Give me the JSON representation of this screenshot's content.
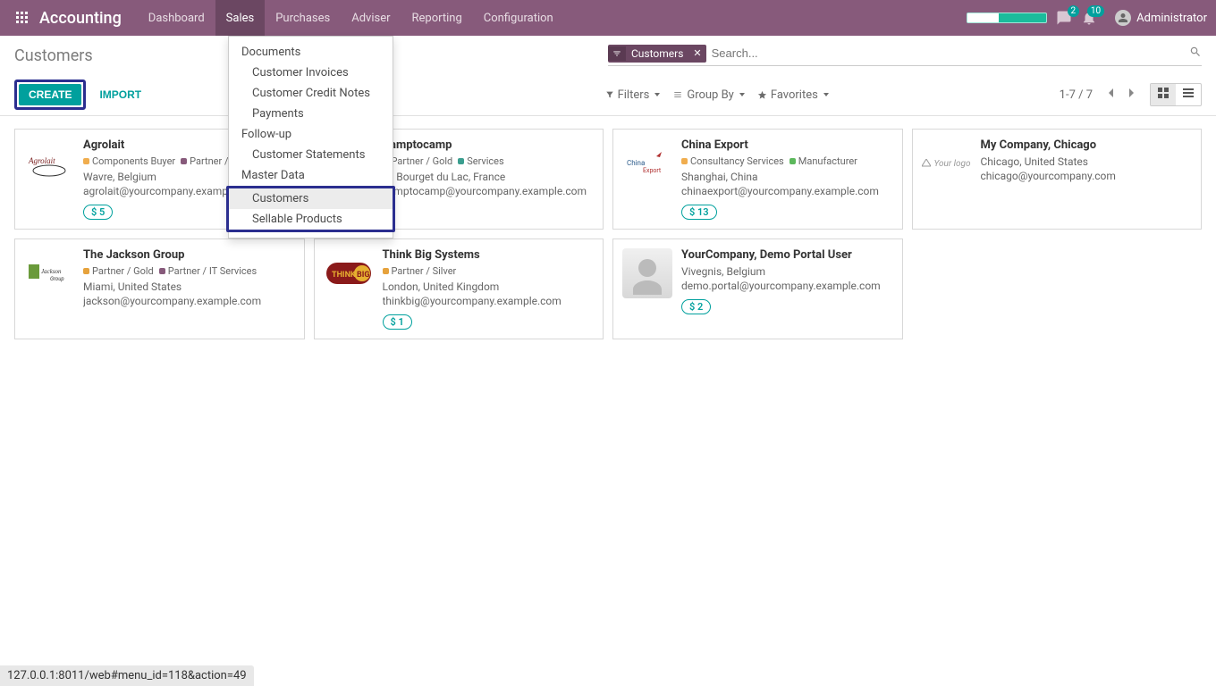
{
  "brand": "Accounting",
  "nav": {
    "items": [
      "Dashboard",
      "Sales",
      "Purchases",
      "Adviser",
      "Reporting",
      "Configuration"
    ],
    "activeIndex": 1
  },
  "topRight": {
    "messagesBadge": "2",
    "activitiesBadge": "10",
    "user": "Administrator"
  },
  "breadcrumb": "Customers",
  "toolbar": {
    "create": "Create",
    "import": "Import"
  },
  "search": {
    "facetLabel": "Customers",
    "placeholder": "Search..."
  },
  "filters": {
    "filters": "Filters",
    "groupBy": "Group By",
    "favorites": "Favorites"
  },
  "pager": "1-7 / 7",
  "dropdown": {
    "sections": [
      {
        "header": "Documents",
        "items": [
          "Customer Invoices",
          "Customer Credit Notes",
          "Payments"
        ]
      },
      {
        "header": "Follow-up",
        "items": [
          "Customer Statements"
        ]
      },
      {
        "header": "Master Data",
        "items": [
          "Customers",
          "Sellable Products"
        ]
      }
    ],
    "activeItem": "Customers"
  },
  "tagColors": {
    "orange": "#f0ad4e",
    "purple": "#875a7b",
    "teal": "#3b9e8f",
    "green": "#5cb85c",
    "gold": "#e6a23c"
  },
  "cards": [
    {
      "title": "Agrolait",
      "tags": [
        {
          "label": "Components Buyer",
          "color": "orange"
        },
        {
          "label": "Partner / IT Services",
          "color": "purple"
        }
      ],
      "loc": "Wavre, Belgium",
      "email": "agrolait@yourcompany.example.com",
      "amount": "$ 5",
      "logo": "agrolait"
    },
    {
      "title": "Camptocamp",
      "tags": [
        {
          "label": "Partner / Gold",
          "color": "orange"
        },
        {
          "label": "Services",
          "color": "teal"
        }
      ],
      "loc": "Le Bourget du Lac, France",
      "email": "camptocamp@yourcompany.example.com",
      "logo": "none"
    },
    {
      "title": "China Export",
      "tags": [
        {
          "label": "Consultancy Services",
          "color": "orange"
        },
        {
          "label": "Manufacturer",
          "color": "green"
        }
      ],
      "loc": "Shanghai, China",
      "email": "chinaexport@yourcompany.example.com",
      "amount": "$ 13",
      "logo": "chinaexport"
    },
    {
      "title": "My Company, Chicago",
      "tags": [],
      "loc": "Chicago, United States",
      "email": "chicago@yourcompany.com",
      "logo": "yourlogo"
    },
    {
      "title": "The Jackson Group",
      "tags": [
        {
          "label": "Partner / Gold",
          "color": "gold"
        },
        {
          "label": "Partner / IT Services",
          "color": "purple"
        }
      ],
      "loc": "Miami, United States",
      "email": "jackson@yourcompany.example.com",
      "logo": "jackson"
    },
    {
      "title": "Think Big Systems",
      "tags": [
        {
          "label": "Partner / Silver",
          "color": "gold"
        }
      ],
      "loc": "London, United Kingdom",
      "email": "thinkbig@yourcompany.example.com",
      "amount": "$ 1",
      "logo": "thinkbig"
    },
    {
      "title": "YourCompany, Demo Portal User",
      "tags": [],
      "loc": "Vivegnis, Belgium",
      "email": "demo.portal@yourcompany.example.com",
      "amount": "$ 2",
      "logo": "person"
    }
  ],
  "statusbar": "127.0.0.1:8011/web#menu_id=118&action=49"
}
